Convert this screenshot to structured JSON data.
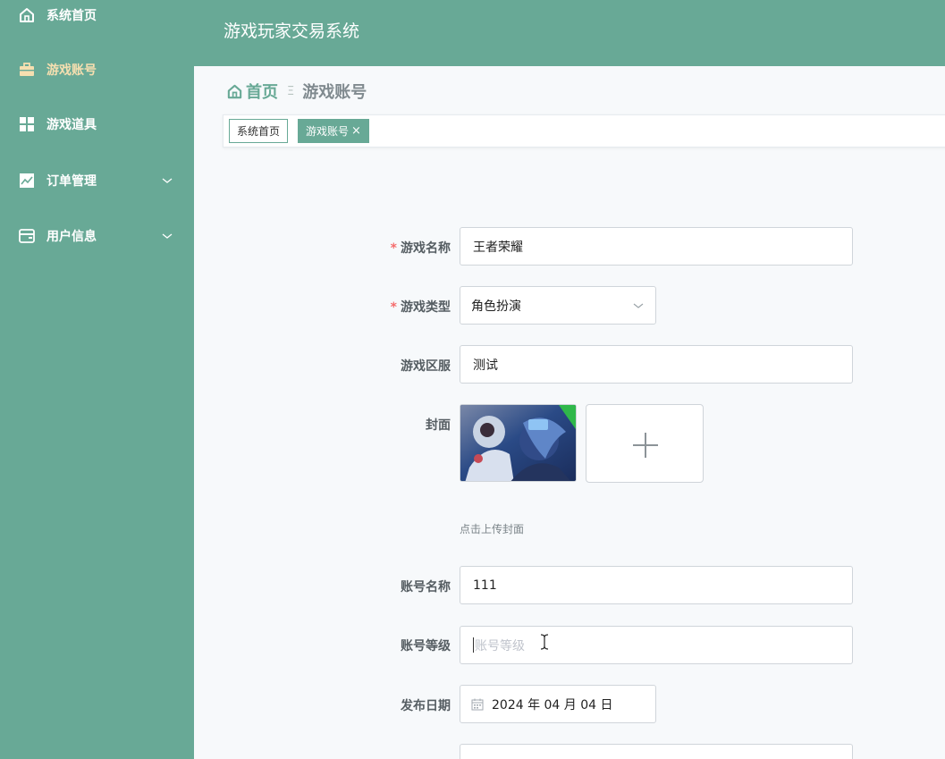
{
  "app": {
    "title": "游戏玩家交易系统"
  },
  "sidebar": {
    "items": [
      {
        "label": "系统首页",
        "icon": "home-icon"
      },
      {
        "label": "游戏账号",
        "icon": "briefcase-icon",
        "active": true
      },
      {
        "label": "游戏道具",
        "icon": "grid-icon"
      },
      {
        "label": "订单管理",
        "icon": "chart-icon",
        "expandable": true
      },
      {
        "label": "用户信息",
        "icon": "wallet-icon",
        "expandable": true
      }
    ]
  },
  "breadcrumb": {
    "home": "首页",
    "separator": "Ξ",
    "current": "游戏账号"
  },
  "tags": [
    {
      "label": "系统首页",
      "active": false
    },
    {
      "label": "游戏账号",
      "active": true,
      "close": "×"
    }
  ],
  "form": {
    "game_name": {
      "label": "游戏名称",
      "required": true,
      "value": "王者荣耀"
    },
    "game_type": {
      "label": "游戏类型",
      "required": true,
      "value": "角色扮演"
    },
    "game_server": {
      "label": "游戏区服",
      "value": "测试"
    },
    "cover": {
      "label": "封面",
      "hint": "点击上传封面"
    },
    "account_name": {
      "label": "账号名称",
      "value": "111"
    },
    "account_level": {
      "label": "账号等级",
      "placeholder": "账号等级"
    },
    "publish_date": {
      "label": "发布日期",
      "value": "2024 年 04 月 04 日"
    }
  },
  "colors": {
    "primary": "#68a996",
    "active_nav": "#f6dfb0",
    "required": "#f56c6c"
  }
}
